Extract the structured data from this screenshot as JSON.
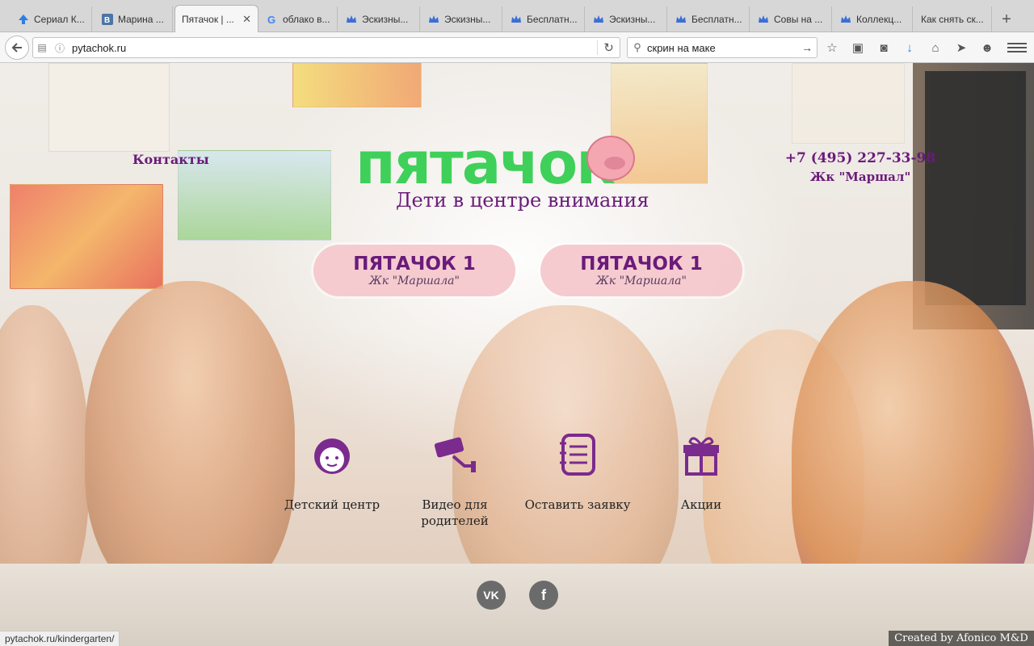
{
  "browser": {
    "tabs": [
      {
        "label": "Сериал К...",
        "icon": "arrow-up-icon",
        "color": "#2f7de1"
      },
      {
        "label": "Марина ...",
        "icon": "vk-icon",
        "color": "#4c75a3"
      },
      {
        "label": "Пятачок | ...",
        "icon": "none",
        "active": true
      },
      {
        "label": "облако в...",
        "icon": "google-icon",
        "color": "#4285f4"
      },
      {
        "label": "Эскизны...",
        "icon": "crown-icon",
        "color": "#3a6fd8"
      },
      {
        "label": "Эскизны...",
        "icon": "crown-icon",
        "color": "#3a6fd8"
      },
      {
        "label": "Бесплатн...",
        "icon": "crown-icon",
        "color": "#3a6fd8"
      },
      {
        "label": "Эскизны...",
        "icon": "crown-icon",
        "color": "#3a6fd8"
      },
      {
        "label": "Бесплатн...",
        "icon": "crown-icon",
        "color": "#3a6fd8"
      },
      {
        "label": "Совы на ...",
        "icon": "crown-icon",
        "color": "#3a6fd8"
      },
      {
        "label": "Коллекц...",
        "icon": "crown-icon",
        "color": "#3a6fd8"
      },
      {
        "label": "Как снять ск...",
        "icon": "none"
      }
    ],
    "url": "pytachok.ru",
    "search_query": "скрин на маке",
    "status_url": "pytachok.ru/kindergarten/"
  },
  "site": {
    "nav_contacts": "Контакты",
    "logo_text": "пятачок",
    "tagline": "Дети в центре внимания",
    "phone": "+7 (495) 227-33-98",
    "address": "Жк \"Маршал\"",
    "branches": [
      {
        "name": "ПЯТАЧОК 1",
        "sub": "Жк \"Маршала\""
      },
      {
        "name": "ПЯТАЧОК 1",
        "sub": "Жк \"Маршала\""
      }
    ],
    "features": [
      {
        "label": "Детский центр",
        "icon": "child-face-icon"
      },
      {
        "label": "Видео для родителей",
        "icon": "security-camera-icon"
      },
      {
        "label": "Оставить заявку",
        "icon": "notepad-icon"
      },
      {
        "label": "Акции",
        "icon": "gift-icon"
      }
    ],
    "social": [
      {
        "label": "VK",
        "icon": "vk-icon"
      },
      {
        "label": "f",
        "icon": "facebook-icon"
      }
    ],
    "credit": "Created by Afonico M&D",
    "colors": {
      "brand_purple": "#6a1b7a",
      "logo_green": "#3fd05a",
      "button_pink": "#f4c8ce",
      "icon_purple": "#7b2a8e"
    }
  }
}
